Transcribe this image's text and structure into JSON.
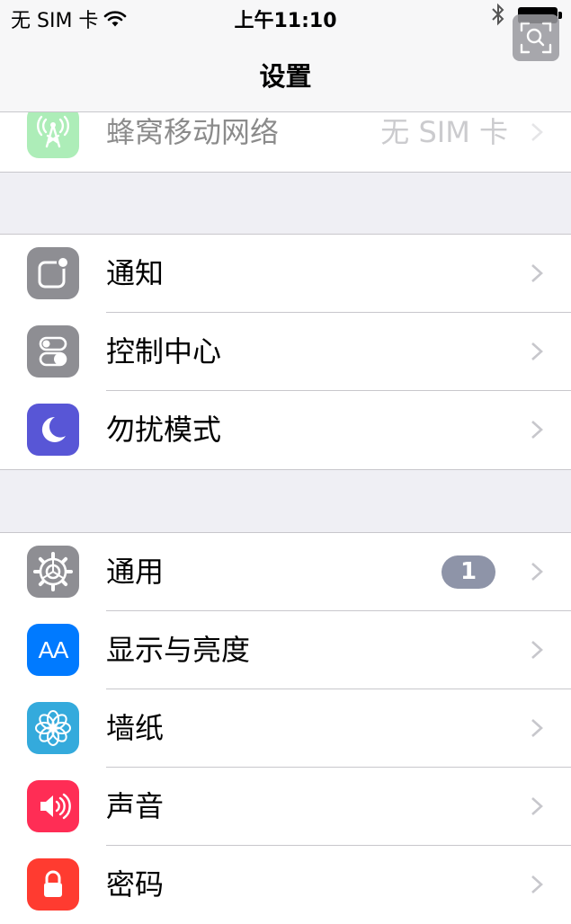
{
  "status_bar": {
    "carrier": "无 SIM 卡",
    "time": "上午11:10",
    "icons": [
      "wifi-icon",
      "bluetooth-icon",
      "battery-icon"
    ]
  },
  "nav": {
    "title": "设置"
  },
  "colors": {
    "background": "#efeff4",
    "cellular": "#4cd964",
    "notifications": "#8e8e93",
    "control_center": "#8e8e93",
    "dnd": "#5856d6",
    "general": "#8e8e93",
    "display": "#007aff",
    "wallpaper": "#34aadc",
    "sounds": "#ff2d55",
    "passcode": "#ff3b30",
    "badge": "#8e94a8"
  },
  "groups": [
    {
      "rows": [
        {
          "label": "蜂窝移动网络",
          "detail": "无 SIM 卡",
          "icon": "cellular-antenna-icon"
        }
      ]
    },
    {
      "rows": [
        {
          "label": "通知",
          "icon": "notifications-icon"
        },
        {
          "label": "控制中心",
          "icon": "control-center-icon"
        },
        {
          "label": "勿扰模式",
          "icon": "moon-icon"
        }
      ]
    },
    {
      "rows": [
        {
          "label": "通用",
          "badge": "1",
          "icon": "gear-icon"
        },
        {
          "label": "显示与亮度",
          "icon": "display-aa-icon",
          "icon_text": "AA"
        },
        {
          "label": "墙纸",
          "icon": "wallpaper-flower-icon"
        },
        {
          "label": "声音",
          "icon": "speaker-icon"
        },
        {
          "label": "密码",
          "icon": "lock-icon"
        }
      ]
    }
  ]
}
